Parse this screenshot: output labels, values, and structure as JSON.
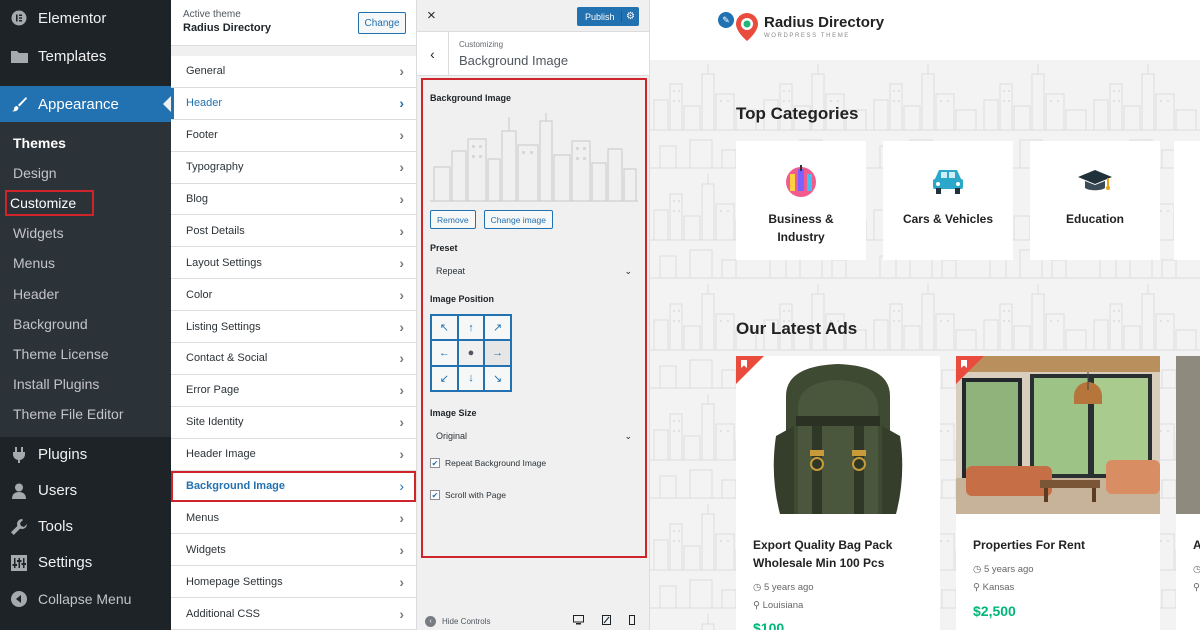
{
  "wp_menu": {
    "elementor": "Elementor",
    "templates": "Templates",
    "appearance": "Appearance",
    "submenu": [
      "Themes",
      "Design",
      "Customize",
      "Widgets",
      "Menus",
      "Header",
      "Background",
      "Theme License",
      "Install Plugins",
      "Theme File Editor"
    ],
    "plugins": "Plugins",
    "users": "Users",
    "tools": "Tools",
    "settings": "Settings",
    "collapse": "Collapse Menu"
  },
  "customizer": {
    "active_theme_label": "Active theme",
    "theme_name": "Radius Directory",
    "change_label": "Change",
    "items": [
      "General",
      "Header",
      "Footer",
      "Typography",
      "Blog",
      "Post Details",
      "Layout Settings",
      "Color",
      "Listing Settings",
      "Contact & Social",
      "Error Page",
      "Site Identity",
      "Header Image",
      "Background Image",
      "Menus",
      "Widgets",
      "Homepage Settings",
      "Additional CSS"
    ]
  },
  "section": {
    "close": "×",
    "publish": "Publish",
    "customizing": "Customizing",
    "title": "Background Image",
    "bg_label": "Background Image",
    "remove": "Remove",
    "change_image": "Change image",
    "preset_label": "Preset",
    "preset_value": "Repeat",
    "position_label": "Image Position",
    "size_label": "Image Size",
    "size_value": "Original",
    "repeat_label": "Repeat Background Image",
    "scroll_label": "Scroll with Page",
    "hide_controls": "Hide Controls"
  },
  "preview": {
    "logo_name": "Radius Directory",
    "logo_tag": "WORDPRESS THEME",
    "top_categories": "Top Categories",
    "categories": [
      {
        "line1": "Business &",
        "line2": "Industry"
      },
      {
        "line1": "Cars & Vehicles",
        "line2": ""
      },
      {
        "line1": "Education",
        "line2": ""
      }
    ],
    "latest_ads": "Our Latest Ads",
    "ads": [
      {
        "title1": "Export Quality Bag Pack",
        "title2": "Wholesale Min 100 Pcs",
        "time": "5 years ago",
        "location": "Louisiana",
        "price": "$100"
      },
      {
        "title1": "Properties For Rent",
        "title2": "",
        "time": "5 years ago",
        "location": "Kansas",
        "price": "$2,500"
      },
      {
        "title1": "A",
        "title2": "",
        "time": "",
        "location": "",
        "price": ""
      }
    ]
  },
  "colors": {
    "wp_admin_bg": "#1d2327",
    "wp_accent": "#2271b1",
    "highlight_red": "#d0242b",
    "price_green": "#00b67a"
  }
}
